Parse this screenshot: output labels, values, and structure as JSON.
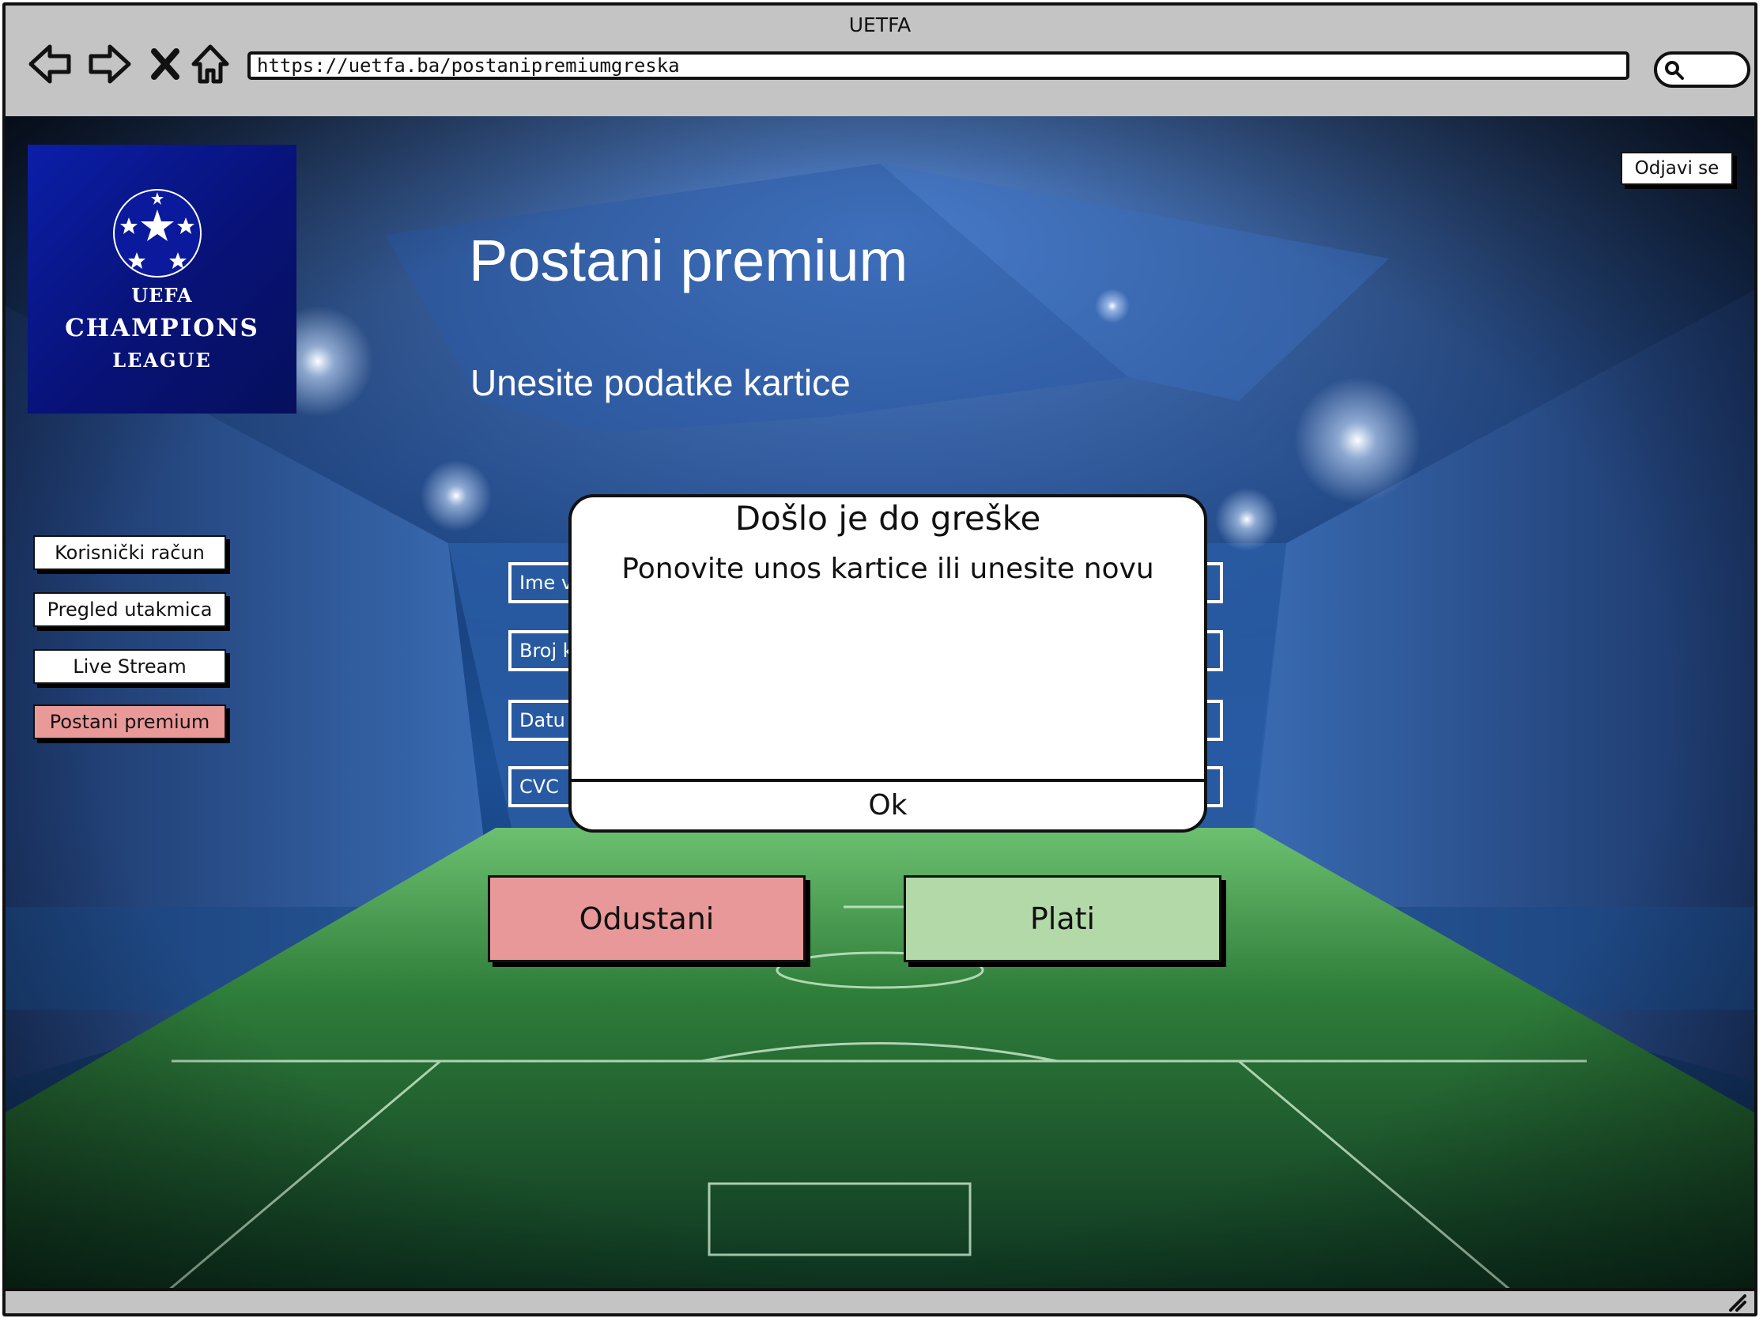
{
  "browser": {
    "window_title": "UETFA",
    "url": "https://uetfa.ba/postanipremiumgreska",
    "icons": [
      "back-arrow-icon",
      "forward-arrow-icon",
      "close-icon",
      "home-icon",
      "search-icon",
      "resize-grip-icon"
    ]
  },
  "logo": {
    "top_text": "UEFA",
    "line1": "CHAMPIONS",
    "line2": "LEAGUE",
    "icon": "starball-icon"
  },
  "header": {
    "logout_label": "Odjavi se"
  },
  "page": {
    "title": "Postani premium",
    "subtitle": "Unesite podatke kartice"
  },
  "sidebar": {
    "items": [
      {
        "label": "Korisnički račun",
        "active": false
      },
      {
        "label": "Pregled utakmica",
        "active": false
      },
      {
        "label": "Live Stream",
        "active": false
      },
      {
        "label": "Postani premium",
        "active": true
      }
    ]
  },
  "form": {
    "fields": [
      {
        "visible_text": "Ime v"
      },
      {
        "visible_text": "Broj k"
      },
      {
        "visible_text": "Datu"
      },
      {
        "visible_text": "CVC"
      }
    ],
    "cancel_label": "Odustani",
    "pay_label": "Plati"
  },
  "dialog": {
    "title": "Došlo je do greške",
    "message": "Ponovite unos kartice ili unesite novu",
    "ok_label": "Ok"
  },
  "colors": {
    "cancel": "#e89898",
    "pay": "#b3d9a8",
    "active_nav": "#ea9999",
    "logo_blue": "#0a1a9c",
    "chrome_gray": "#c4c4c4"
  }
}
